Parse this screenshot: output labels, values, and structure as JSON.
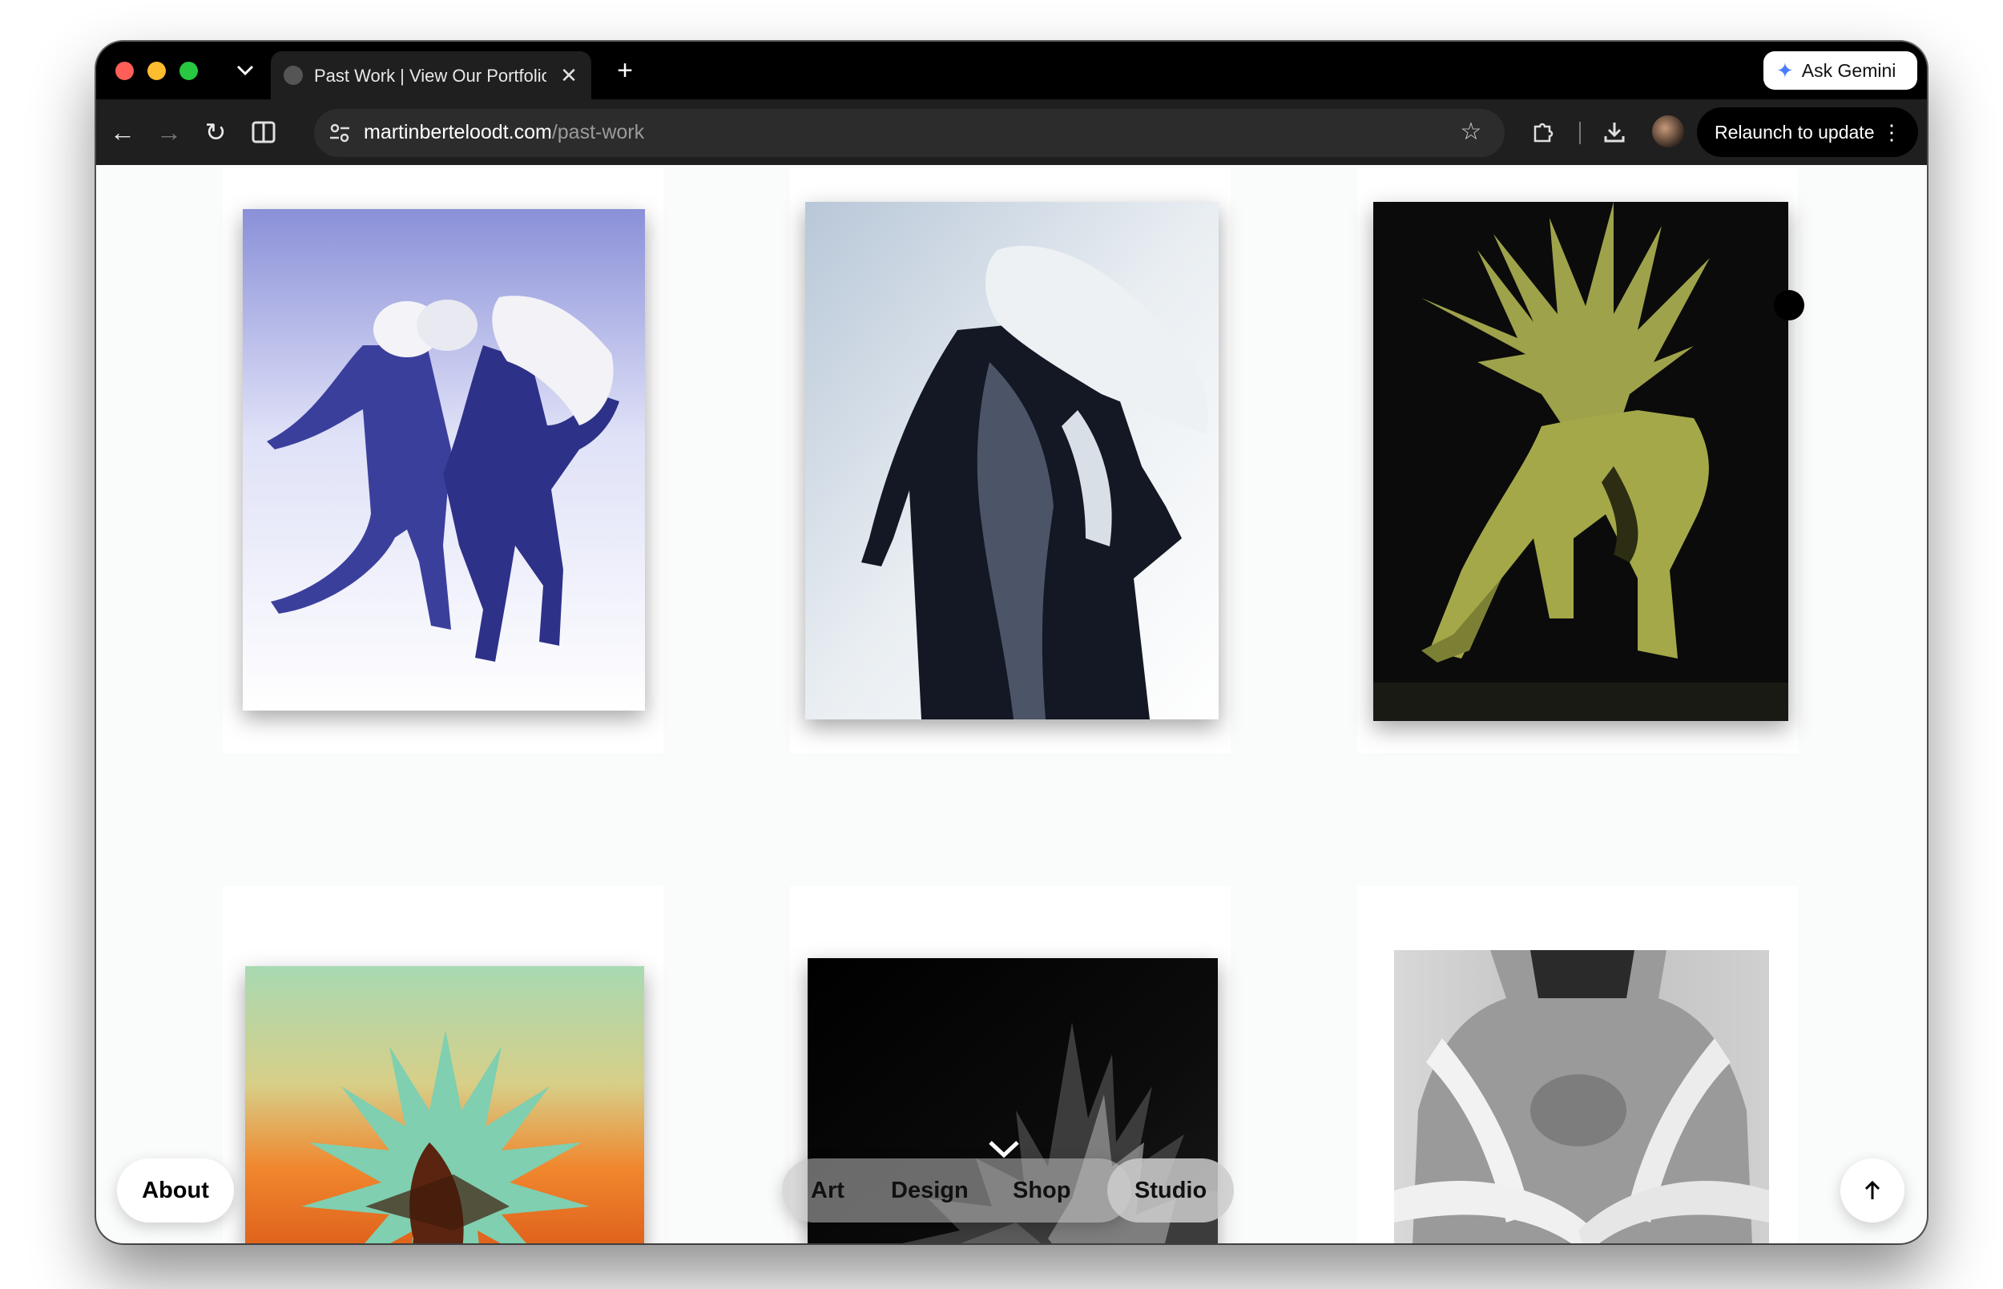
{
  "browser": {
    "tab_title": "Past Work | View Our Portfolio",
    "close_glyph": "✕",
    "new_tab_glyph": "+",
    "gemini_label": "Ask Gemini",
    "url_domain": "martinberteloodt.com",
    "url_path": "/past-work",
    "relaunch_label": "Relaunch to update",
    "star_glyph": "☆",
    "back_glyph": "←",
    "forward_glyph": "→",
    "reload_glyph": "↻",
    "menu_glyph": "⋮",
    "gemini_glyph": "✦"
  },
  "page": {
    "about_label": "About",
    "nav": [
      "Art",
      "Design",
      "Shop",
      "Studio"
    ],
    "artworks": [
      {
        "name": "blue-dancing-figures",
        "palette": [
          "#3b3f9c",
          "#ffffff"
        ]
      },
      {
        "name": "draped-figure",
        "palette": [
          "#141824",
          "#e9eef2"
        ]
      },
      {
        "name": "spiked-creature",
        "palette": [
          "#0b0b0b",
          "#a4a848"
        ]
      },
      {
        "name": "spiked-sculpture-sunset",
        "palette": [
          "#e25a14",
          "#a8d9b2"
        ]
      },
      {
        "name": "dark-spiked-texture",
        "palette": [
          "#050505",
          "#8a8a8a"
        ]
      },
      {
        "name": "torso-with-bands",
        "palette": [
          "#cfcfcf",
          "#5a5a5a"
        ]
      }
    ]
  },
  "colors": {
    "close": "#ff5f57",
    "minimize": "#febc2e",
    "zoom": "#28c840",
    "page_background": "#fafbfb"
  }
}
